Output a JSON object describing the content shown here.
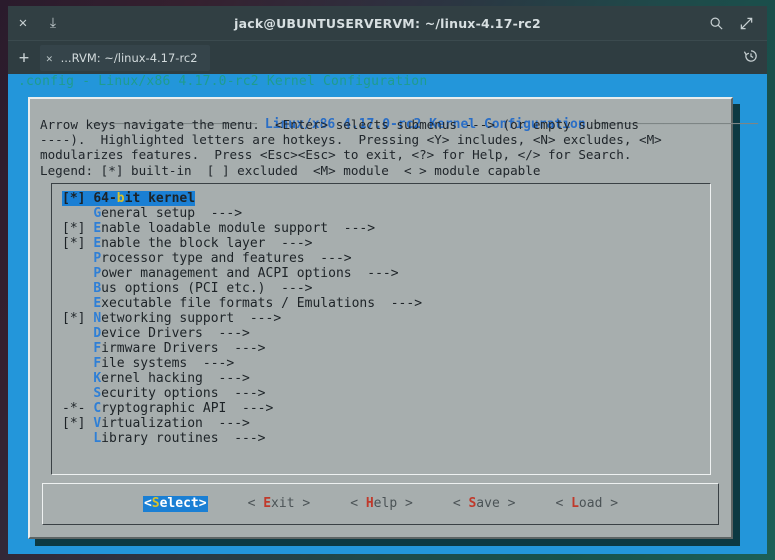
{
  "window": {
    "title": "jack@UBUNTUSERVERVM: ~/linux-4.17-rc2",
    "close_icon": "✕",
    "download_icon": "⤓",
    "search_icon": "search-icon",
    "expand_icon": "expand-icon"
  },
  "tabbar": {
    "new_tab_icon": "+",
    "tab_close_icon": "✕",
    "tab_label": "...RVM: ~/linux-4.17-rc2",
    "history_icon": "history-icon"
  },
  "terminal": {
    "shell_header": ".config - Linux/x86 4.17.0-rc2 Kernel Configuration"
  },
  "dialog": {
    "title": "Linux/x86 4.17.0-rc2 Kernel Configuration",
    "title_dash_left": "───────────────────── ",
    "title_dash_right": " ─────────────────────",
    "help_lines": [
      "Arrow keys navigate the menu.  <Enter> selects submenus ---> (or empty submenus",
      "----).  Highlighted letters are hotkeys.  Pressing <Y> includes, <N> excludes, <M>",
      "modularizes features.  Press <Esc><Esc> to exit, <?> for Help, </> for Search.",
      "Legend: [*] built-in  [ ] excluded  <M> module  < > module capable"
    ],
    "menu_items": [
      {
        "mark": "[*] ",
        "hot": "b",
        "pre": "64-",
        "post": "it kernel",
        "arrow": "",
        "selected": true
      },
      {
        "mark": "    ",
        "hot": "G",
        "pre": "",
        "post": "eneral setup",
        "arrow": "  --->",
        "selected": false
      },
      {
        "mark": "[*] ",
        "hot": "E",
        "pre": "",
        "post": "nable loadable module support",
        "arrow": "  --->",
        "selected": false
      },
      {
        "mark": "[*] ",
        "hot": "E",
        "pre": "",
        "post": "nable the block layer",
        "arrow": "  --->",
        "selected": false
      },
      {
        "mark": "    ",
        "hot": "P",
        "pre": "",
        "post": "rocessor type and features",
        "arrow": "  --->",
        "selected": false
      },
      {
        "mark": "    ",
        "hot": "P",
        "pre": "",
        "post": "ower management and ACPI options",
        "arrow": "  --->",
        "selected": false
      },
      {
        "mark": "    ",
        "hot": "B",
        "pre": "",
        "post": "us options (PCI etc.)",
        "arrow": "  --->",
        "selected": false
      },
      {
        "mark": "    ",
        "hot": "E",
        "pre": "",
        "post": "xecutable file formats / Emulations",
        "arrow": "  --->",
        "selected": false
      },
      {
        "mark": "[*] ",
        "hot": "N",
        "pre": "",
        "post": "etworking support",
        "arrow": "  --->",
        "selected": false
      },
      {
        "mark": "    ",
        "hot": "D",
        "pre": "",
        "post": "evice Drivers",
        "arrow": "  --->",
        "selected": false
      },
      {
        "mark": "    ",
        "hot": "F",
        "pre": "",
        "post": "irmware Drivers",
        "arrow": "  --->",
        "selected": false
      },
      {
        "mark": "    ",
        "hot": "F",
        "pre": "",
        "post": "ile systems",
        "arrow": "  --->",
        "selected": false
      },
      {
        "mark": "    ",
        "hot": "K",
        "pre": "",
        "post": "ernel hacking",
        "arrow": "  --->",
        "selected": false
      },
      {
        "mark": "    ",
        "hot": "S",
        "pre": "",
        "post": "ecurity options",
        "arrow": "  --->",
        "selected": false
      },
      {
        "mark": "-*- ",
        "hot": "C",
        "pre": "",
        "post": "ryptographic API",
        "arrow": "  --->",
        "selected": false
      },
      {
        "mark": "[*] ",
        "hot": "V",
        "pre": "",
        "post": "irtualization",
        "arrow": "  --->",
        "selected": false
      },
      {
        "mark": "    ",
        "hot": "L",
        "pre": "",
        "post": "ibrary routines",
        "arrow": "  --->",
        "selected": false
      }
    ],
    "buttons": [
      {
        "open": "<",
        "hot": "S",
        "rest": "elect",
        "close": ">",
        "active": true
      },
      {
        "open": "< ",
        "hot": "E",
        "rest": "xit",
        "close": " >",
        "active": false
      },
      {
        "open": "< ",
        "hot": "H",
        "rest": "elp",
        "close": " >",
        "active": false
      },
      {
        "open": "< ",
        "hot": "S",
        "rest": "ave",
        "close": " >",
        "active": false
      },
      {
        "open": "< ",
        "hot": "L",
        "rest": "oad",
        "close": " >",
        "active": false
      }
    ]
  },
  "colors": {
    "terminal_bg": "#2396da",
    "dialog_bg": "#a7aeae",
    "highlight": "#1a7fd4",
    "hotkey": "#2f7fd6",
    "hotkey_selected": "#d8c12b",
    "button_hotkey": "#c0392b",
    "shell_header": "#1f9c8e"
  }
}
